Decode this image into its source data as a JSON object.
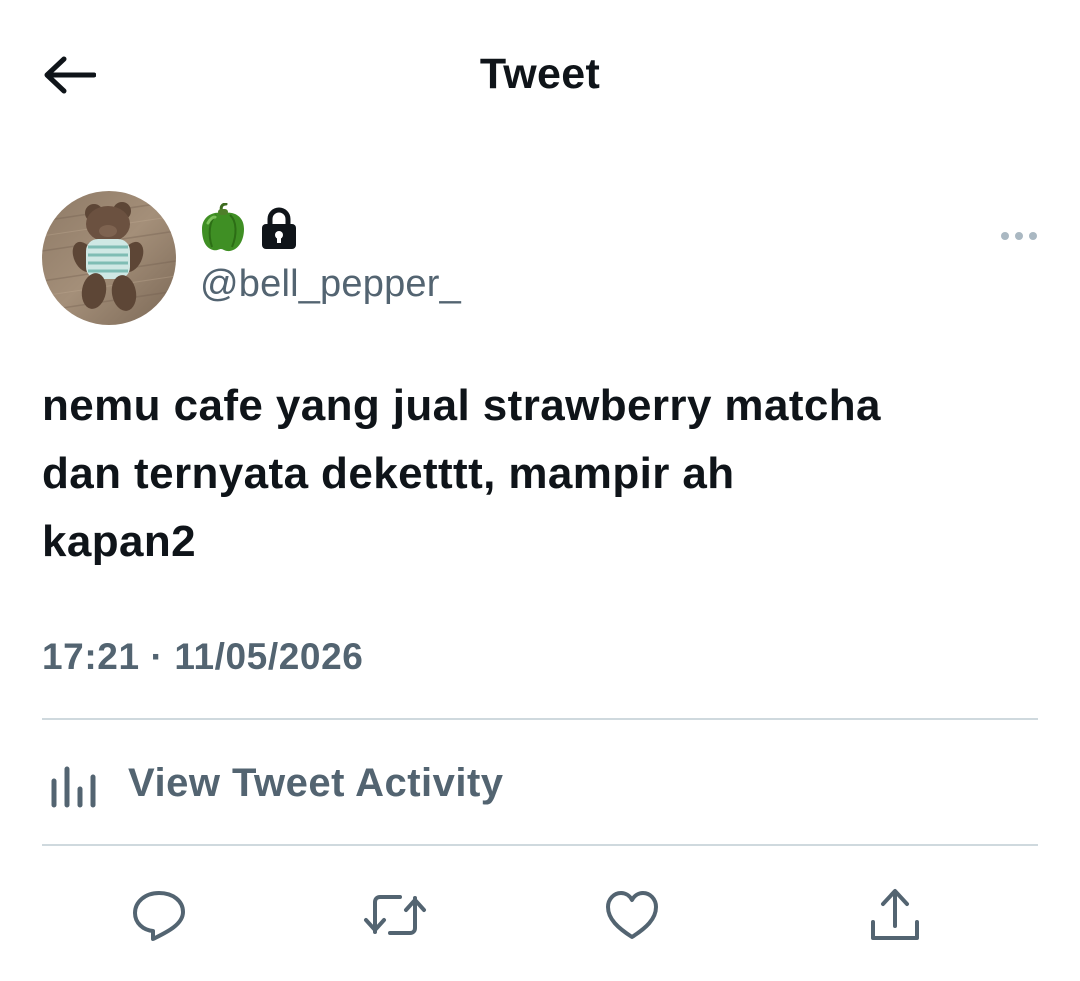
{
  "header": {
    "title": "Tweet",
    "back_icon": "arrow-left-icon"
  },
  "author": {
    "display_emoji": "🫑",
    "protected_icon": "lock-icon",
    "handle": "@bell_pepper_",
    "more_icon": "more-horizontal-icon"
  },
  "tweet": {
    "text": "nemu cafe yang jual strawberry matcha\ndan ternyata deketttt, mampir ah\nkapan2",
    "timestamp": "17:21 · 11/05/2026"
  },
  "activity": {
    "label": "View Tweet Activity",
    "icon": "bar-chart-icon"
  },
  "actions": [
    {
      "name": "reply",
      "icon": "reply-icon"
    },
    {
      "name": "retweet",
      "icon": "retweet-icon"
    },
    {
      "name": "like",
      "icon": "heart-icon"
    },
    {
      "name": "share",
      "icon": "share-icon"
    }
  ],
  "colors": {
    "text_primary": "#0f1419",
    "text_secondary": "#536471",
    "divider": "#cfd9de",
    "icon_gray": "#536471"
  }
}
